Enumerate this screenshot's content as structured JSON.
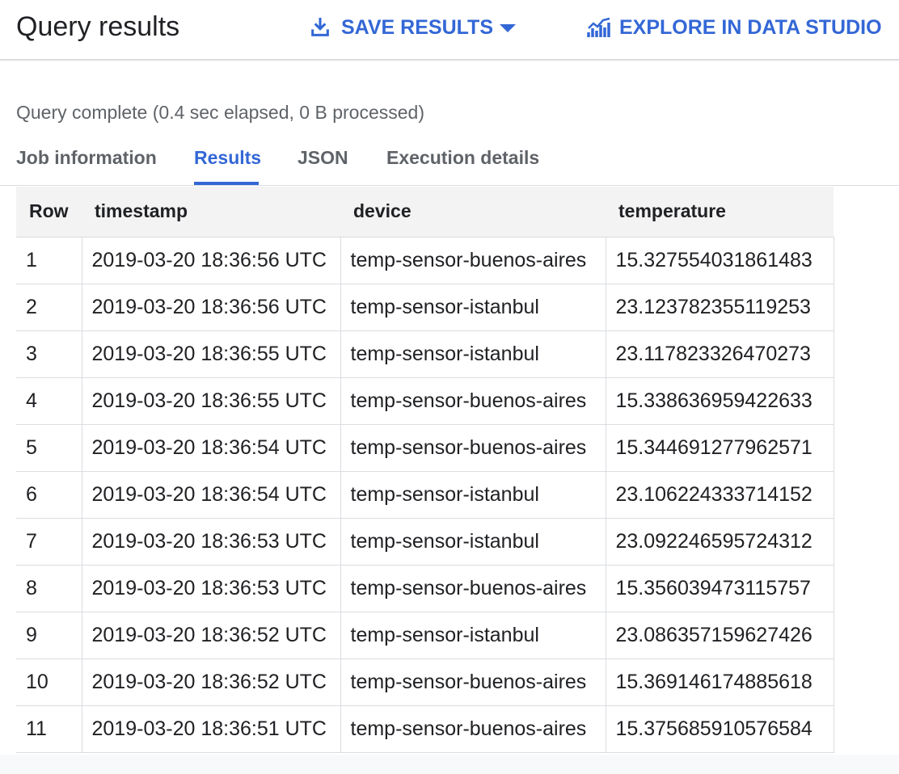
{
  "header": {
    "title": "Query results",
    "save_label": "SAVE RESULTS",
    "explore_label": "EXPLORE IN DATA STUDIO"
  },
  "status": "Query complete (0.4 sec elapsed, 0 B processed)",
  "tabs": [
    {
      "label": "Job information"
    },
    {
      "label": "Results"
    },
    {
      "label": "JSON"
    },
    {
      "label": "Execution details"
    }
  ],
  "table": {
    "columns": [
      "Row",
      "timestamp",
      "device",
      "temperature"
    ],
    "rows": [
      [
        "1",
        "2019-03-20 18:36:56 UTC",
        "temp-sensor-buenos-aires",
        "15.327554031861483"
      ],
      [
        "2",
        "2019-03-20 18:36:56 UTC",
        "temp-sensor-istanbul",
        "23.123782355119253"
      ],
      [
        "3",
        "2019-03-20 18:36:55 UTC",
        "temp-sensor-istanbul",
        "23.117823326470273"
      ],
      [
        "4",
        "2019-03-20 18:36:55 UTC",
        "temp-sensor-buenos-aires",
        "15.338636959422633"
      ],
      [
        "5",
        "2019-03-20 18:36:54 UTC",
        "temp-sensor-buenos-aires",
        "15.344691277962571"
      ],
      [
        "6",
        "2019-03-20 18:36:54 UTC",
        "temp-sensor-istanbul",
        "23.106224333714152"
      ],
      [
        "7",
        "2019-03-20 18:36:53 UTC",
        "temp-sensor-istanbul",
        "23.092246595724312"
      ],
      [
        "8",
        "2019-03-20 18:36:53 UTC",
        "temp-sensor-buenos-aires",
        "15.356039473115757"
      ],
      [
        "9",
        "2019-03-20 18:36:52 UTC",
        "temp-sensor-istanbul",
        "23.086357159627426"
      ],
      [
        "10",
        "2019-03-20 18:36:52 UTC",
        "temp-sensor-buenos-aires",
        "15.369146174885618"
      ],
      [
        "11",
        "2019-03-20 18:36:51 UTC",
        "temp-sensor-buenos-aires",
        "15.375685910576584"
      ]
    ]
  },
  "colors": {
    "accent": "#3367d6",
    "text": "#202124",
    "muted": "#5f6368",
    "border": "#dadce0",
    "header_bg": "#f3f3f3"
  },
  "icons": {
    "save": "download-icon",
    "dropdown": "caret-down-icon",
    "explore": "chart-icon"
  }
}
